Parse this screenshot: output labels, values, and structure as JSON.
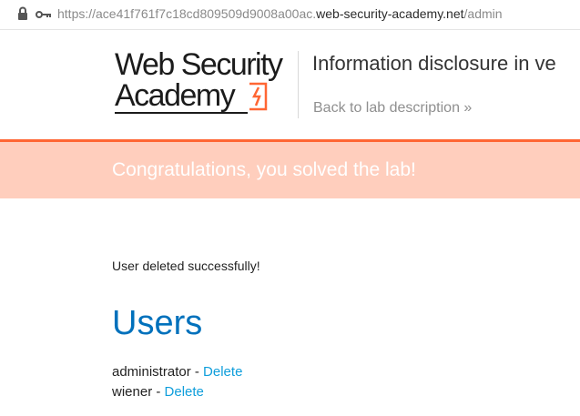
{
  "browser": {
    "url_prefix": "https://ace41f761f7c18cd809509d9008a00ac.",
    "url_host": "web-security-academy.net",
    "url_path": "/admin",
    "lock_icon": "lock-icon",
    "key_icon": "key-icon"
  },
  "header": {
    "logo_line1": "Web Security",
    "logo_line2": "Academy",
    "lab_title": "Information disclosure in ve",
    "back_link": "Back to lab description »"
  },
  "banner": {
    "text": "Congratulations, you solved the lab!",
    "accent_color": "#ff6633",
    "background_color": "#ffcebd"
  },
  "main": {
    "message": "User deleted successfully!",
    "heading": "Users",
    "separator": " - ",
    "users": [
      {
        "name": "administrator",
        "action": "Delete"
      },
      {
        "name": "wiener",
        "action": "Delete"
      }
    ]
  }
}
